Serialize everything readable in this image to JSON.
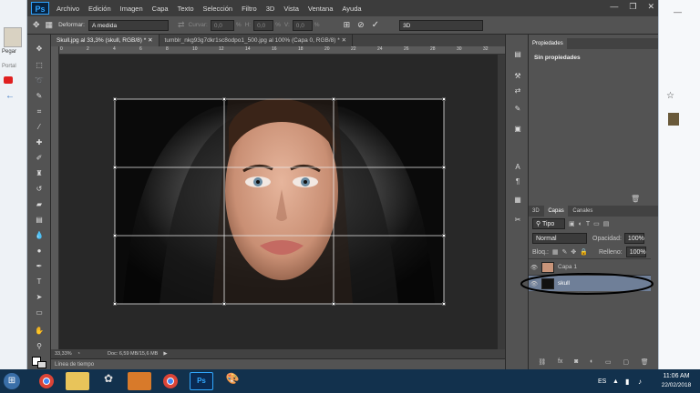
{
  "app": {
    "logo": "Ps"
  },
  "menu": [
    "Archivo",
    "Edición",
    "Imagen",
    "Capa",
    "Texto",
    "Selección",
    "Filtro",
    "3D",
    "Vista",
    "Ventana",
    "Ayuda"
  ],
  "options": {
    "deformar_label": "Deformar:",
    "deformar_value": "A medida",
    "curvar_label": "Curvar:",
    "curvar_value": "0,0",
    "h_label": "H:",
    "h_value": "0,0",
    "v_label": "V:",
    "v_value": "0,0",
    "pct1": "%",
    "pct2": "%",
    "pct3": "%",
    "workspace": "3D"
  },
  "tabs": [
    {
      "label": "Skull.jpg al 33,3% (skull, RGB/8) *"
    },
    {
      "label": "tumblr_nkg93g7dkr1sc8odpo1_500.jpg al 100% (Capa 0, RGB/8) *"
    }
  ],
  "ruler_ticks": [
    "0",
    "2",
    "4",
    "6",
    "8",
    "10",
    "12",
    "14",
    "16",
    "18",
    "20",
    "22",
    "24",
    "26",
    "28",
    "30",
    "32"
  ],
  "status": {
    "zoom": "33,33%",
    "doc": "Doc: 6,59 MB/15,6 MB"
  },
  "timeline": {
    "label": "Línea de tiempo"
  },
  "properties": {
    "tab": "Propiedades",
    "content": "Sin propiedades"
  },
  "layers_panel": {
    "tabs": [
      "3D",
      "Capas",
      "Canales"
    ],
    "filter": "Tipo",
    "blend": "Normal",
    "opacity_label": "Opacidad:",
    "opacity": "100%",
    "lock_label": "Bloq.:",
    "fill_label": "Relleno:",
    "fill": "100%",
    "layers": [
      {
        "name": "Capa 1"
      },
      {
        "name": "skull"
      }
    ]
  },
  "left_app": {
    "paste": "Pegar",
    "portal": "Portal"
  },
  "taskbar": {
    "lang": "ES",
    "time": "11:06 AM",
    "date": "22/02/2018"
  }
}
